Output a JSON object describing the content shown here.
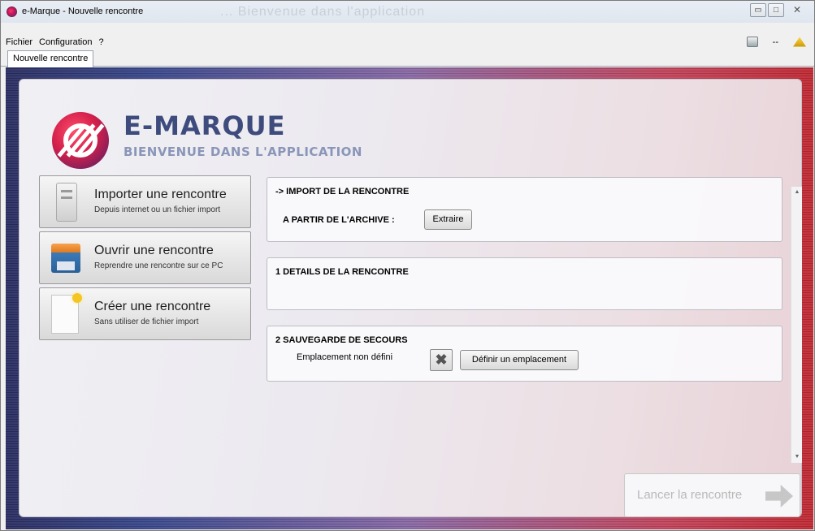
{
  "window": {
    "title": "e-Marque - Nouvelle rencontre",
    "background_title": "... Bienvenue dans l'application",
    "min_label": "▭",
    "max_label": "□",
    "close_label": "✕"
  },
  "menu": {
    "items": [
      "Fichier",
      "Configuration",
      "?"
    ],
    "status_text": "--"
  },
  "tabs": [
    {
      "label": "Nouvelle rencontre",
      "active": true
    }
  ],
  "brand": {
    "title": "E-MARQUE",
    "subtitle": "BIENVENUE DANS L'APPLICATION"
  },
  "actions": [
    {
      "title": "Importer une rencontre",
      "subtitle": "Depuis internet ou un fichier import",
      "icon": "computer-icon"
    },
    {
      "title": "Ouvrir une rencontre",
      "subtitle": "Reprendre une rencontre sur ce PC",
      "icon": "floppy-disk-icon"
    },
    {
      "title": "Créer une rencontre",
      "subtitle": "Sans utiliser de fichier import",
      "icon": "new-document-icon"
    }
  ],
  "sections": {
    "import": {
      "title": "-> IMPORT DE LA RENCONTRE",
      "archive_label": "A PARTIR DE L'ARCHIVE :",
      "extract_button": "Extraire"
    },
    "details": {
      "title": "1  DETAILS DE LA RENCONTRE"
    },
    "backup": {
      "title": "2  SAUVEGARDE DE SECOURS",
      "location_status": "Emplacement non défini",
      "clear_button": "✖",
      "define_button": "Définir un emplacement"
    }
  },
  "launch": {
    "label": "Lancer la rencontre",
    "enabled": false
  },
  "colors": {
    "brand_blue": "#3e4c7d",
    "brand_red": "#d4204a",
    "frame_left": "#2b2f63",
    "frame_right": "#c22a34"
  }
}
